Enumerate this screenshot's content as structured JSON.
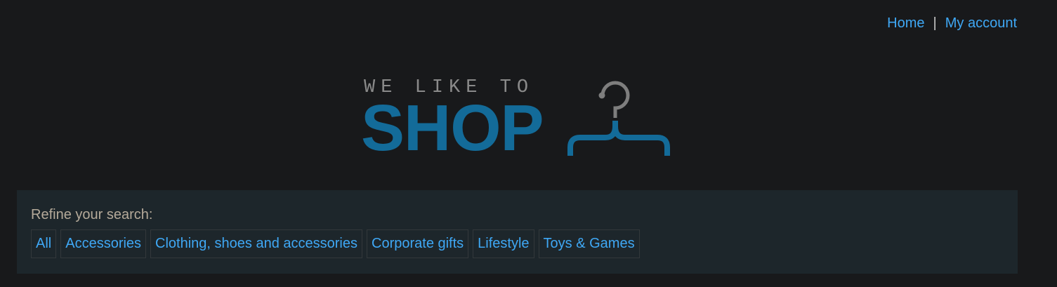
{
  "nav": {
    "home": "Home",
    "separator": "|",
    "account": "My account"
  },
  "logo": {
    "tagline": "WE LIKE TO",
    "brand": "SHOP",
    "icon": "hanger-icon",
    "colors": {
      "tagline": "#8a8a8a",
      "brand": "#136b99"
    }
  },
  "filters": {
    "label": "Refine your search:",
    "items": [
      {
        "label": "All"
      },
      {
        "label": "Accessories"
      },
      {
        "label": "Clothing, shoes and accessories"
      },
      {
        "label": "Corporate gifts"
      },
      {
        "label": "Lifestyle"
      },
      {
        "label": "Toys & Games"
      }
    ]
  },
  "colors": {
    "background": "#18191b",
    "panel": "#1d262b",
    "link": "#3fa8f5"
  }
}
